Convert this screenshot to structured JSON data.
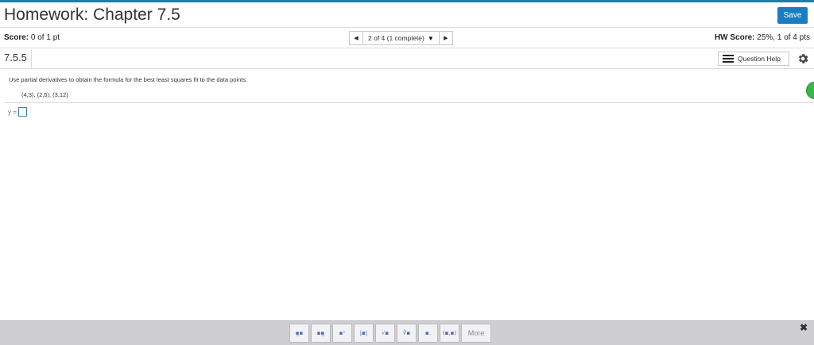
{
  "header": {
    "title": "Homework: Chapter 7.5",
    "save_label": "Save"
  },
  "score_bar": {
    "score_label": "Score:",
    "score_value": "0 of 1 pt",
    "nav_text": "2 of 4 (1 complete)",
    "hw_score_label": "HW Score:",
    "hw_score_value": "25%, 1 of 4 pts"
  },
  "section": {
    "id": "7.5.5",
    "question_help_label": "Question Help"
  },
  "question": {
    "prompt": "Use partial derivatives to obtain the formula for the best least squares fit to the data points.",
    "data_points": "(4,3), (2,6), (3,12)",
    "answer_prefix": "y ="
  },
  "toolbar": {
    "buttons": [
      {
        "glyph": "▪̲▪",
        "name": "fraction-tool"
      },
      {
        "glyph": "▪▪̲",
        "name": "mixed-number-tool"
      },
      {
        "glyph": "▪ˣ",
        "name": "exponent-tool"
      },
      {
        "glyph": "|▪|",
        "name": "absolute-value-tool"
      },
      {
        "glyph": "√▪",
        "name": "square-root-tool"
      },
      {
        "glyph": "∛▪",
        "name": "nth-root-tool"
      },
      {
        "glyph": "▪.",
        "name": "decimal-tool"
      },
      {
        "glyph": "(▪,▪)",
        "name": "ordered-pair-tool"
      }
    ],
    "more_label": "More",
    "close_glyph": "✖"
  }
}
